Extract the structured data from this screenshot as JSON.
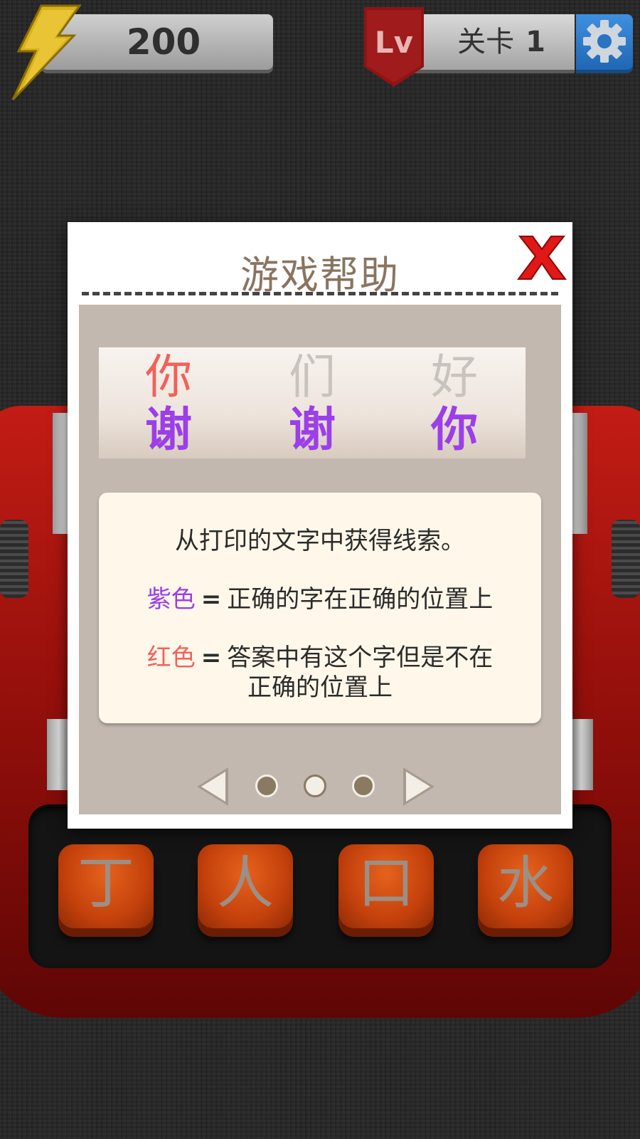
{
  "hud": {
    "energy": "200",
    "level_badge": "Lv",
    "level_label": "关卡",
    "level_number": "1"
  },
  "keys": [
    "丁",
    "人",
    "口",
    "水"
  ],
  "dialog": {
    "title": "游戏帮助",
    "close_label": "X",
    "example": {
      "row1": [
        {
          "char": "你",
          "color": "#f2615a"
        },
        {
          "char": "们",
          "color": "#c8c3bf"
        },
        {
          "char": "好",
          "color": "#c8c3bf"
        }
      ],
      "row2": [
        {
          "char": "谢",
          "color": "#9b3fe8"
        },
        {
          "char": "谢",
          "color": "#9b3fe8"
        },
        {
          "char": "你",
          "color": "#9b3fe8"
        }
      ]
    },
    "rules": {
      "intro": "从打印的文字中获得线索。",
      "purple_label": "紫色",
      "purple_desc": "正确的字在正确的位置上",
      "red_label": "红色",
      "red_desc_line1": "答案中有这个字但是不在",
      "red_desc_line2": "正确的位置上",
      "equals": "="
    },
    "pager": {
      "page_count": 3,
      "current_page": 2
    }
  },
  "colors": {
    "purple": "#9b3fe8",
    "red": "#f2615a",
    "title": "#8a7460",
    "close": "#e01818"
  }
}
